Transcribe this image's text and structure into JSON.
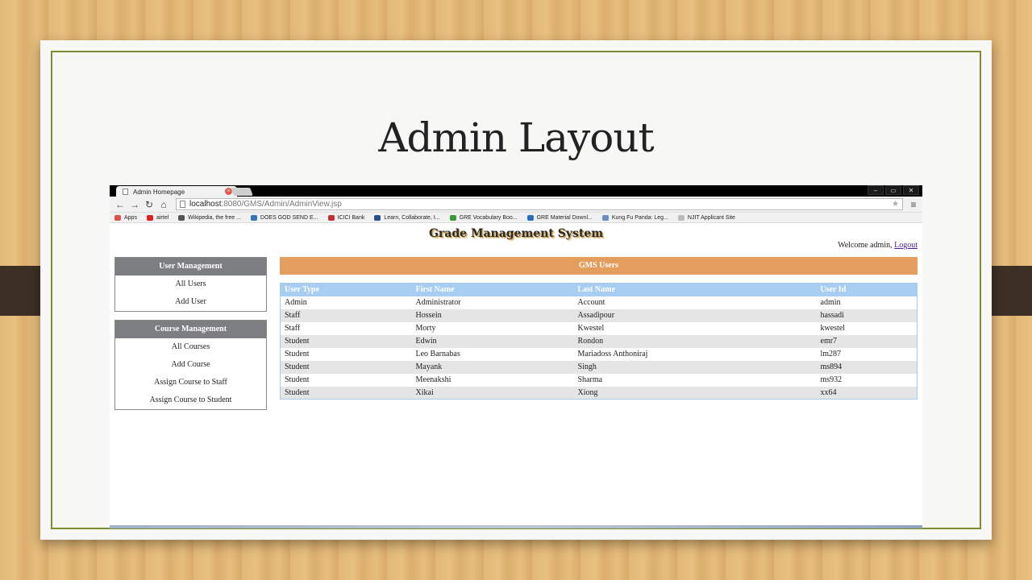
{
  "slide": {
    "title": "Admin Layout"
  },
  "browser": {
    "tab_title": "Admin Homepage",
    "tab_close": "×",
    "window_controls": [
      "–",
      "▭",
      "✕"
    ],
    "url_host": "localhost",
    "url_rest": ":8080/GMS/Admin/AdminView.jsp",
    "bookmarks": [
      {
        "label": "Apps",
        "color": "#d9534f"
      },
      {
        "label": "airtel",
        "color": "#e02020"
      },
      {
        "label": "Wikipedia, the free ...",
        "color": "#555555"
      },
      {
        "label": "DOES GOD SEND E...",
        "color": "#3a74b8"
      },
      {
        "label": "ICICI Bank",
        "color": "#c03030"
      },
      {
        "label": "Learn, Collaborate, I...",
        "color": "#2a4f8a"
      },
      {
        "label": "GRE Vocabulary Boo...",
        "color": "#3a9a3a"
      },
      {
        "label": "GRE Material Downl...",
        "color": "#2d6bbf"
      },
      {
        "label": "Kung Fu Panda: Leg...",
        "color": "#6a8ec0"
      },
      {
        "label": "NJIT Applicant Site",
        "color": "#bbbbbb"
      }
    ]
  },
  "app": {
    "title": "Grade Management System",
    "welcome_text": "Welcome admin,",
    "logout_label": "Logout",
    "user_management": {
      "heading": "User Management",
      "items": [
        "All Users",
        "Add User"
      ]
    },
    "course_management": {
      "heading": "Course Management",
      "items": [
        "All Courses",
        "Add Course",
        "Assign Course to Staff",
        "Assign Course to Student"
      ]
    },
    "users_section_title": "GMS Users",
    "table": {
      "headers": [
        "User Type",
        "First Name",
        "Last Name",
        "User Id"
      ],
      "rows": [
        [
          "Admin",
          "Administrator",
          "Account",
          "admin"
        ],
        [
          "Staff",
          "Hossein",
          "Assadipour",
          "hassadi"
        ],
        [
          "Staff",
          "Morty",
          "Kwestel",
          "kwestel"
        ],
        [
          "Student",
          "Edwin",
          "Rondon",
          "emr7"
        ],
        [
          "Student",
          "Leo Barnabas",
          "Mariadoss Anthoniraj",
          "lm287"
        ],
        [
          "Student",
          "Mayank",
          "Singh",
          "ms894"
        ],
        [
          "Student",
          "Meenakshi",
          "Sharma",
          "ms932"
        ],
        [
          "Student",
          "Xikai",
          "Xiong",
          "xx64"
        ]
      ]
    }
  },
  "colors": {
    "panel_header": "#7d7e82",
    "gms_bar": "#e39d5c",
    "table_header": "#a7cdf0",
    "frame_border": "#7a8c2e"
  }
}
